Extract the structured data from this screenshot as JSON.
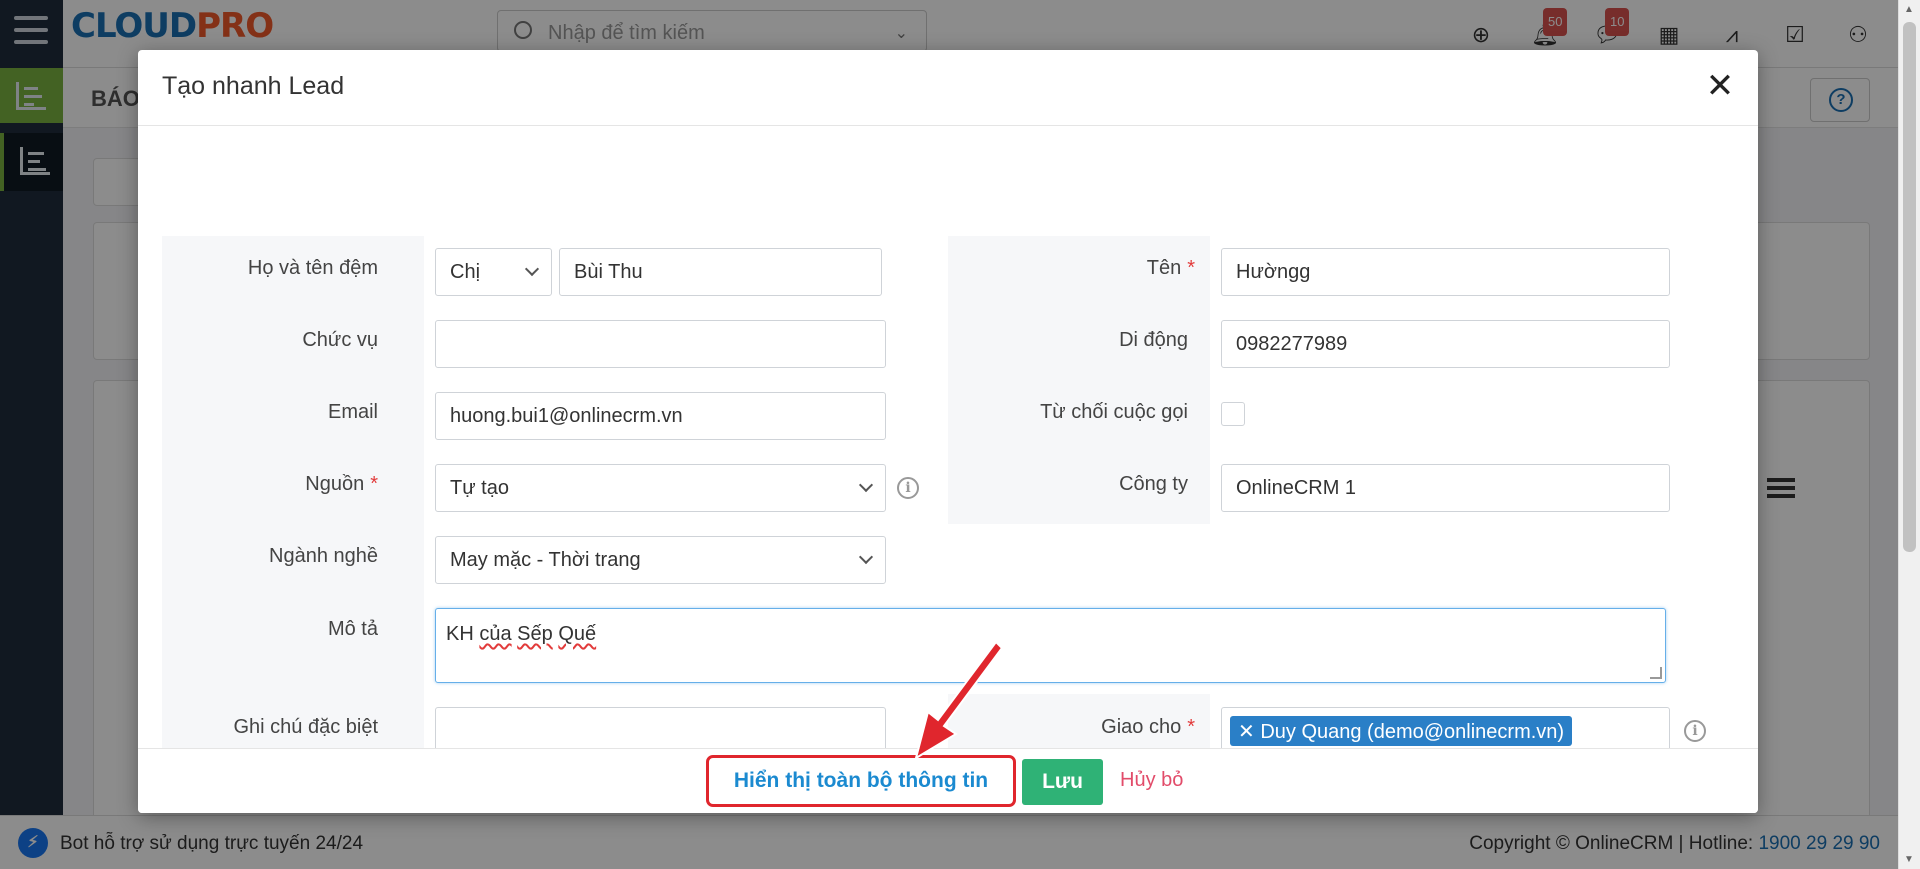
{
  "app": {
    "logo": {
      "main": "CLOUD",
      "accent": "PRO"
    },
    "search": {
      "placeholder": "Nhập để tìm kiếm"
    },
    "notifications": {
      "count": "50"
    },
    "messages": {
      "count": "10"
    },
    "page_title": "BÁO",
    "footer": {
      "bot_text": "Bot hỗ trợ sử dụng trực tuyến 24/24",
      "copyright": "Copyright © OnlineCRM | Hotline: ",
      "hotline": "1900 29 29 90"
    }
  },
  "modal": {
    "title": "Tạo nhanh Lead",
    "close_symbol": "✕",
    "fields": {
      "full_name_label": "Họ và tên đệm",
      "salutation": "Chị",
      "middle_name": "Bùi Thu",
      "first_name_label": "Tên",
      "first_name": "Hườngg",
      "position_label": "Chức vụ",
      "position": "",
      "mobile_label": "Di động",
      "mobile": "0982277989",
      "email_label": "Email",
      "email": "huong.bui1@onlinecrm.vn",
      "do_not_call_label": "Từ chối cuộc gọi",
      "source_label": "Nguồn",
      "source": "Tự tạo",
      "company_label": "Công ty",
      "company": "OnlineCRM 1",
      "industry_label": "Ngành nghề",
      "industry": "May mặc - Thời trang",
      "description_label": "Mô tả",
      "description_word1": "KH",
      "description_word2": "của",
      "description_word3": "Sếp",
      "description_word4": "Quế",
      "special_note_label": "Ghi chú đặc biệt",
      "special_note": "",
      "assigned_to_label": "Giao cho",
      "assigned_to": "Duy Quang (demo@onlinecrm.vn)",
      "required_mark": "*"
    },
    "footer": {
      "show_all": "Hiển thị toàn bộ thông tin",
      "save": "Lưu",
      "cancel": "Hủy bỏ"
    }
  },
  "colors": {
    "save": "#2fb276",
    "cancel": "#e24c6a",
    "highlight": "#e0262d",
    "link": "#1b8ad0",
    "tag": "#2a7fc7"
  }
}
